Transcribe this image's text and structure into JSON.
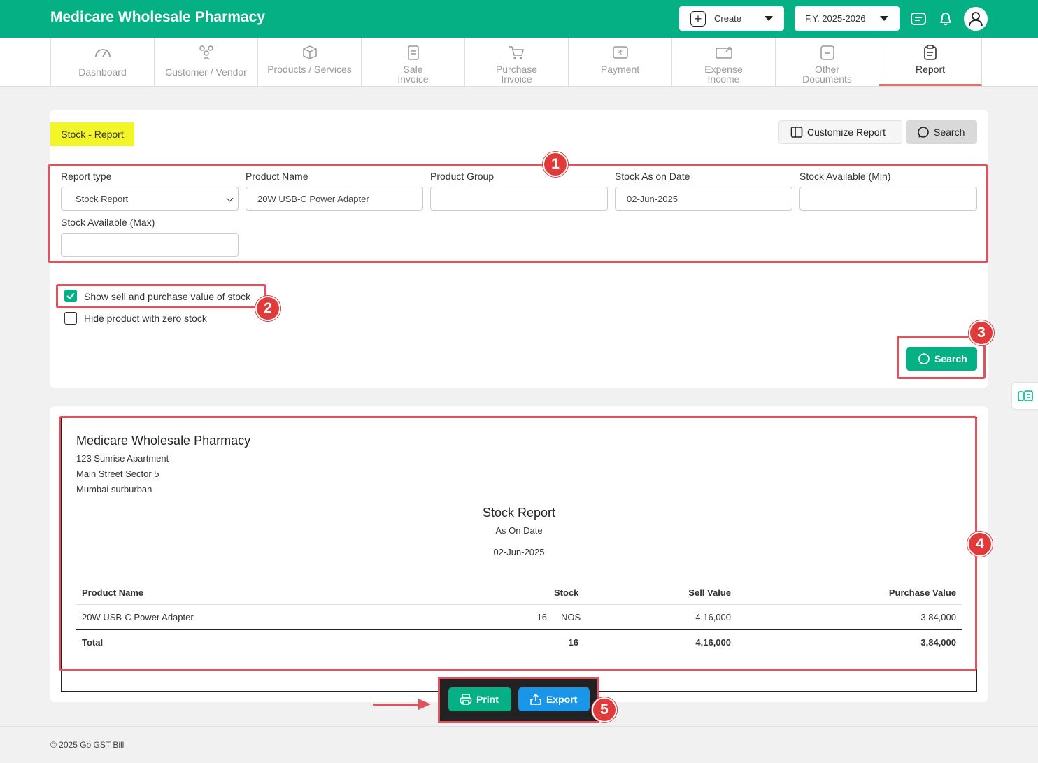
{
  "header": {
    "company": "Medicare Wholesale Pharmacy",
    "create_label": "Create",
    "fy_label": "F.Y. 2025-2026"
  },
  "nav": {
    "items": [
      {
        "label": "Dashboard"
      },
      {
        "label": "Customer / Vendor"
      },
      {
        "label": "Products / Services"
      },
      {
        "label": "Sale",
        "label2": "Invoice"
      },
      {
        "label": "Purchase",
        "label2": "Invoice"
      },
      {
        "label": "Payment"
      },
      {
        "label": "Expense",
        "label2": "Income"
      },
      {
        "label": "Other",
        "label2": "Documents"
      },
      {
        "label": "Report"
      }
    ],
    "active": "Report"
  },
  "filter": {
    "page_title": "Stock - Report",
    "customize_label": "Customize Report",
    "search_label": "Search",
    "report_type": {
      "label": "Report type",
      "value": "Stock Report"
    },
    "product_name": {
      "label": "Product Name",
      "value": "20W USB-C Power Adapter"
    },
    "product_group": {
      "label": "Product Group",
      "value": ""
    },
    "stock_date": {
      "label": "Stock As on Date",
      "value": "02-Jun-2025"
    },
    "stock_min": {
      "label": "Stock Available (Min)",
      "value": ""
    },
    "stock_max": {
      "label": "Stock Available (Max)",
      "value": ""
    },
    "show_value_label": "Show sell and purchase value of stock",
    "show_value_checked": true,
    "hide_zero_label": "Hide product with zero stock",
    "hide_zero_checked": false,
    "search_button": "Search"
  },
  "report": {
    "company": "Medicare Wholesale Pharmacy",
    "address": [
      "123 Sunrise Apartment",
      "Main Street Sector 5",
      "Mumbai surburban"
    ],
    "title": "Stock Report",
    "subtitle": "As On Date",
    "date": "02-Jun-2025",
    "columns": {
      "product": "Product Name",
      "stock": "Stock",
      "sell": "Sell Value",
      "purchase": "Purchase Value"
    },
    "rows": [
      {
        "product": "20W USB-C Power Adapter",
        "qty": "16",
        "unit": "NOS",
        "sell": "4,16,000",
        "purchase": "3,84,000"
      }
    ],
    "total": {
      "label": "Total",
      "qty": "16",
      "sell": "4,16,000",
      "purchase": "3,84,000"
    }
  },
  "actions": {
    "print": "Print",
    "export": "Export"
  },
  "annotations": [
    "1",
    "2",
    "3",
    "4",
    "5"
  ],
  "footer": "© 2025 Go GST Bill",
  "colors": {
    "brand": "#05b184",
    "export": "#1a96e8",
    "annotation": "#e0525e",
    "highlight": "#f2f528"
  }
}
